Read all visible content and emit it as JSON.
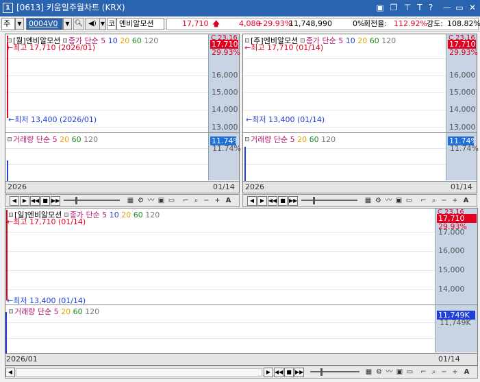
{
  "window": {
    "number": "1",
    "title": "[0613] 키움일주월차트 (KRX)",
    "controls": [
      "▣",
      "❐",
      "📌",
      "T",
      "?",
      "—",
      "▭",
      "✕"
    ]
  },
  "toolbar": {
    "market": "주",
    "code": "0004V0",
    "stock_prefix": "코",
    "stock_name": "엔비알모션",
    "price": "17,710",
    "change": "4,080",
    "change_rate": "+29.93%",
    "volume": "11,748,990",
    "ratio": "0%",
    "turnover_label": "회전율:",
    "turnover": "112.92%",
    "strength_label": "강도:",
    "strength": "108.82%"
  },
  "colors": {
    "up": "#e1001e",
    "down": "#1f3ed6",
    "accent": "#2a63ae"
  },
  "panels": {
    "monthly": {
      "legend_title": "[월]엔비알모션",
      "high_note": "←최고 17,710 (2026/01)",
      "low_note": "←최저 13,400 (2026/01)",
      "axis_labels": [
        "16,000",
        "15,000",
        "14,000",
        "13,000"
      ],
      "price_tag": "17,710",
      "price_tag2": "29.93%",
      "price_top": "C 23,16",
      "vol_tag": "11.74%",
      "vol_tag2": "11.74%",
      "date_left": "2026",
      "date_right": "01/14"
    },
    "weekly": {
      "legend_title": "[주]엔비알모션",
      "high_note": "←최고 17,710 (01/14)",
      "low_note": "←최저 13,400 (01/14)",
      "axis_labels": [
        "16,000",
        "15,000",
        "14,000",
        "13,000"
      ],
      "price_tag": "17,710",
      "price_tag2": "29.93%",
      "price_top": "C 23,16",
      "vol_tag": "11.74%",
      "vol_tag2": "11.74%",
      "date_left": "2026",
      "date_right": "01/14"
    },
    "daily": {
      "legend_title": "[일]엔비알모션",
      "high_note": "←최고 17,710 (01/14)",
      "low_note": "←최저 13,400 (01/14)",
      "axis_labels": [
        "17,000",
        "16,000",
        "15,000",
        "14,000"
      ],
      "price_tag": "17,710",
      "price_tag2": "29.93%",
      "price_top": "C 23,16",
      "vol_tag": "11,749K",
      "vol_tag2": "11,749K",
      "date_left": "2026/01",
      "date_right": "01/14"
    }
  },
  "legend": {
    "ma_prefix": "종가 단순",
    "ma5": "5",
    "ma10": "10",
    "ma20": "20",
    "ma60": "60",
    "ma120": "120",
    "vol_label": "거래량",
    "vol_ma": "단순",
    "vol5": "5",
    "vol20": "20",
    "vol60": "60",
    "vol120": "120"
  },
  "nav": {
    "buttons": [
      "◀",
      "▶",
      "◀◀",
      "■",
      "▶▶"
    ],
    "icons": [
      "▦",
      "⚙",
      "〰",
      "▣",
      "▭",
      "⌐",
      "🔍",
      "−",
      "+",
      "A"
    ]
  }
}
